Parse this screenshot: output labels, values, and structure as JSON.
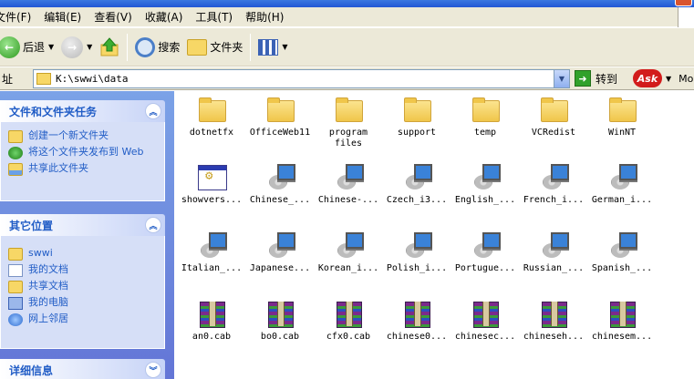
{
  "window": {
    "title": ""
  },
  "menu": [
    "文件(F)",
    "编辑(E)",
    "查看(V)",
    "收藏(A)",
    "工具(T)",
    "帮助(H)"
  ],
  "toolbar": {
    "back_label": "后退",
    "search_label": "搜索",
    "folders_label": "文件夹"
  },
  "address": {
    "label": "址",
    "value": "K:\\swwi\\data",
    "go_label": "转到",
    "ask_label": "Ask",
    "more_label": "Mo"
  },
  "tasks": {
    "title": "文件和文件夹任务",
    "items": [
      {
        "label": "创建一个新文件夹",
        "icon": "new-folder-icon"
      },
      {
        "label": "将这个文件夹发布到 Web",
        "icon": "publish-web-icon"
      },
      {
        "label": "共享此文件夹",
        "icon": "share-folder-icon"
      }
    ]
  },
  "other_places": {
    "title": "其它位置",
    "items": [
      {
        "label": "swwi",
        "icon": "folder-icon"
      },
      {
        "label": "我的文档",
        "icon": "my-documents-icon"
      },
      {
        "label": "共享文档",
        "icon": "shared-documents-icon"
      },
      {
        "label": "我的电脑",
        "icon": "my-computer-icon"
      },
      {
        "label": "网上邻居",
        "icon": "network-places-icon"
      }
    ]
  },
  "details": {
    "title": "详细信息"
  },
  "files": [
    {
      "name": "dotnetfx",
      "type": "folder"
    },
    {
      "name": "OfficeWeb11",
      "type": "folder"
    },
    {
      "name": "program files",
      "type": "folder"
    },
    {
      "name": "support",
      "type": "folder"
    },
    {
      "name": "temp",
      "type": "folder"
    },
    {
      "name": "VCRedist",
      "type": "folder"
    },
    {
      "name": "WinNT",
      "type": "folder"
    },
    {
      "name": "showvers...",
      "type": "app"
    },
    {
      "name": "Chinese_...",
      "type": "setup"
    },
    {
      "name": "Chinese-...",
      "type": "setup"
    },
    {
      "name": "Czech_i3...",
      "type": "setup"
    },
    {
      "name": "English_...",
      "type": "setup"
    },
    {
      "name": "French_i...",
      "type": "setup"
    },
    {
      "name": "German_i...",
      "type": "setup"
    },
    {
      "name": "Italian_...",
      "type": "setup"
    },
    {
      "name": "Japanese...",
      "type": "setup"
    },
    {
      "name": "Korean_i...",
      "type": "setup"
    },
    {
      "name": "Polish_i...",
      "type": "setup"
    },
    {
      "name": "Portugue...",
      "type": "setup"
    },
    {
      "name": "Russian_...",
      "type": "setup"
    },
    {
      "name": "Spanish_...",
      "type": "setup"
    },
    {
      "name": "an0.cab",
      "type": "cab"
    },
    {
      "name": "bo0.cab",
      "type": "cab"
    },
    {
      "name": "cfx0.cab",
      "type": "cab"
    },
    {
      "name": "chinese0...",
      "type": "cab"
    },
    {
      "name": "chinesec...",
      "type": "cab"
    },
    {
      "name": "chineseh...",
      "type": "cab"
    },
    {
      "name": "chinesem...",
      "type": "cab"
    }
  ]
}
